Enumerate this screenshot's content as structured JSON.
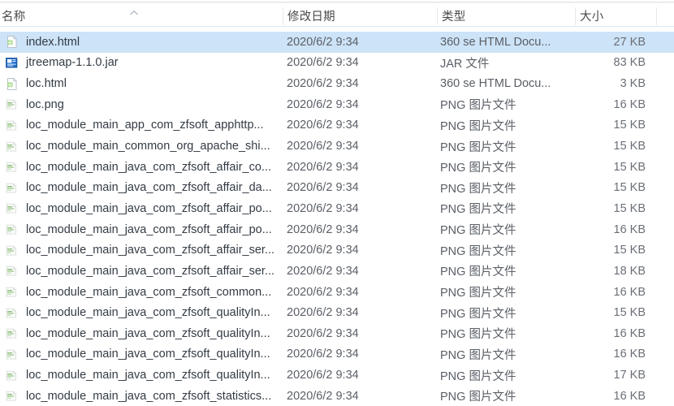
{
  "window": {
    "view": "details",
    "selection_color": "#cde3f7"
  },
  "columns": [
    {
      "key": "name",
      "label": "名称",
      "sorted": true,
      "sort_direction": "ascending",
      "sort_icon": "chevron-up-icon"
    },
    {
      "key": "date",
      "label": "修改日期",
      "sorted": false
    },
    {
      "key": "type",
      "label": "类型",
      "sorted": false
    },
    {
      "key": "size",
      "label": "大小",
      "sorted": false
    }
  ],
  "files": [
    {
      "name": "index.html",
      "date": "2020/6/2 9:34",
      "type": "360 se HTML Docu...",
      "size": "27 KB",
      "icon": "html-file-icon",
      "selected": true
    },
    {
      "name": "jtreemap-1.1.0.jar",
      "date": "2020/6/2 9:34",
      "type": "JAR 文件",
      "size": "83 KB",
      "icon": "jar-file-icon",
      "selected": false
    },
    {
      "name": "loc.html",
      "date": "2020/6/2 9:34",
      "type": "360 se HTML Docu...",
      "size": "3 KB",
      "icon": "html-file-icon",
      "selected": false
    },
    {
      "name": "loc.png",
      "date": "2020/6/2 9:34",
      "type": "PNG 图片文件",
      "size": "16 KB",
      "icon": "png-file-icon",
      "selected": false
    },
    {
      "name": "loc_module_main_app_com_zfsoft_apphttp...",
      "date": "2020/6/2 9:34",
      "type": "PNG 图片文件",
      "size": "15 KB",
      "icon": "png-file-icon",
      "selected": false
    },
    {
      "name": "loc_module_main_common_org_apache_shi...",
      "date": "2020/6/2 9:34",
      "type": "PNG 图片文件",
      "size": "15 KB",
      "icon": "png-file-icon",
      "selected": false
    },
    {
      "name": "loc_module_main_java_com_zfsoft_affair_co...",
      "date": "2020/6/2 9:34",
      "type": "PNG 图片文件",
      "size": "15 KB",
      "icon": "png-file-icon",
      "selected": false
    },
    {
      "name": "loc_module_main_java_com_zfsoft_affair_da...",
      "date": "2020/6/2 9:34",
      "type": "PNG 图片文件",
      "size": "15 KB",
      "icon": "png-file-icon",
      "selected": false
    },
    {
      "name": "loc_module_main_java_com_zfsoft_affair_po...",
      "date": "2020/6/2 9:34",
      "type": "PNG 图片文件",
      "size": "15 KB",
      "icon": "png-file-icon",
      "selected": false
    },
    {
      "name": "loc_module_main_java_com_zfsoft_affair_po...",
      "date": "2020/6/2 9:34",
      "type": "PNG 图片文件",
      "size": "16 KB",
      "icon": "png-file-icon",
      "selected": false
    },
    {
      "name": "loc_module_main_java_com_zfsoft_affair_ser...",
      "date": "2020/6/2 9:34",
      "type": "PNG 图片文件",
      "size": "15 KB",
      "icon": "png-file-icon",
      "selected": false
    },
    {
      "name": "loc_module_main_java_com_zfsoft_affair_ser...",
      "date": "2020/6/2 9:34",
      "type": "PNG 图片文件",
      "size": "18 KB",
      "icon": "png-file-icon",
      "selected": false
    },
    {
      "name": "loc_module_main_java_com_zfsoft_common...",
      "date": "2020/6/2 9:34",
      "type": "PNG 图片文件",
      "size": "16 KB",
      "icon": "png-file-icon",
      "selected": false
    },
    {
      "name": "loc_module_main_java_com_zfsoft_qualityIn...",
      "date": "2020/6/2 9:34",
      "type": "PNG 图片文件",
      "size": "15 KB",
      "icon": "png-file-icon",
      "selected": false
    },
    {
      "name": "loc_module_main_java_com_zfsoft_qualityIn...",
      "date": "2020/6/2 9:34",
      "type": "PNG 图片文件",
      "size": "16 KB",
      "icon": "png-file-icon",
      "selected": false
    },
    {
      "name": "loc_module_main_java_com_zfsoft_qualityIn...",
      "date": "2020/6/2 9:34",
      "type": "PNG 图片文件",
      "size": "16 KB",
      "icon": "png-file-icon",
      "selected": false
    },
    {
      "name": "loc_module_main_java_com_zfsoft_qualityIn...",
      "date": "2020/6/2 9:34",
      "type": "PNG 图片文件",
      "size": "17 KB",
      "icon": "png-file-icon",
      "selected": false
    },
    {
      "name": "loc_module_main_java_com_zfsoft_statistics...",
      "date": "2020/6/2 9:34",
      "type": "PNG 图片文件",
      "size": "16 KB",
      "icon": "png-file-icon",
      "selected": false
    }
  ]
}
